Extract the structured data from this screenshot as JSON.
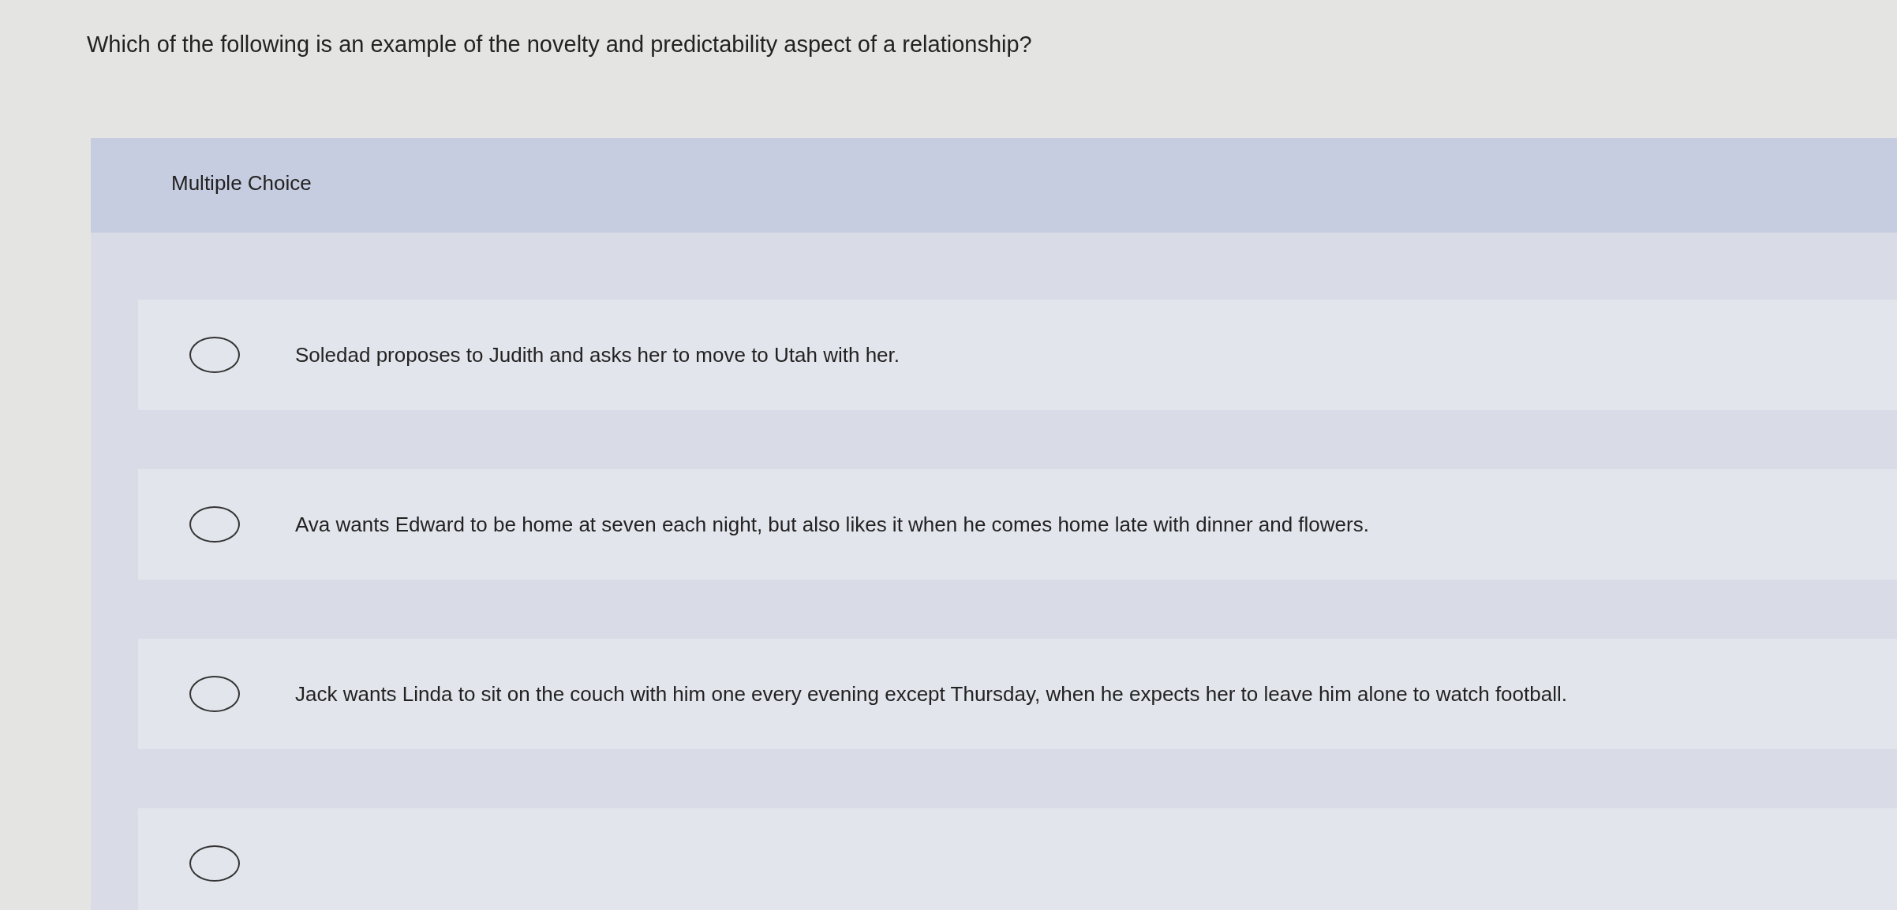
{
  "question": "Which of the following is an example of the novelty and predictability aspect of a relationship?",
  "section_label": "Multiple Choice",
  "options": [
    {
      "text": "Soledad proposes to Judith and asks her to move to Utah with her.",
      "selected": false
    },
    {
      "text": "Ava wants Edward to be home at seven each night, but also likes it when he comes home late with dinner and flowers.",
      "selected": false
    },
    {
      "text": "Jack wants Linda to sit on the couch with him one every evening except Thursday, when he expects her to leave him alone to watch football.",
      "selected": false
    },
    {
      "selected": false
    }
  ]
}
